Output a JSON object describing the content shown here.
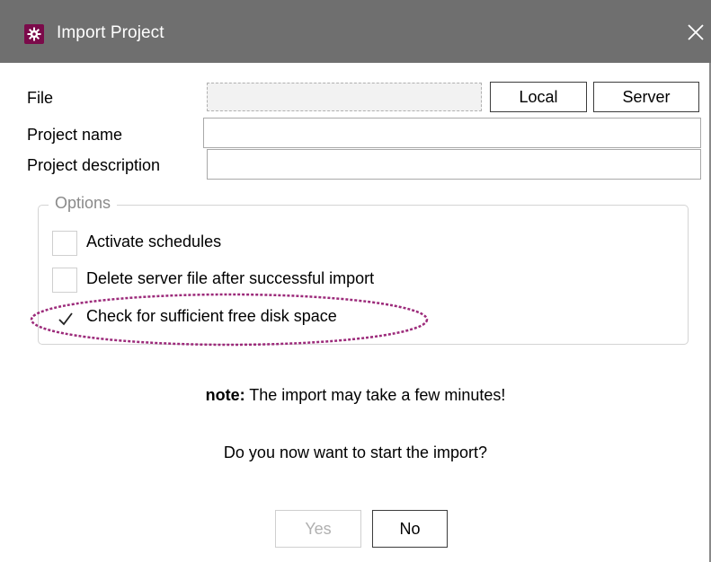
{
  "window": {
    "title": "Import Project",
    "titlebar_color": "#6f6f6f",
    "icon": "gear-icon",
    "close_icon": "close-icon"
  },
  "form": {
    "file_label": "File",
    "file_value": "",
    "local_button": "Local",
    "server_button": "Server",
    "name_label": "Project name",
    "name_value": "",
    "description_label": "Project description",
    "description_value": ""
  },
  "options": {
    "legend": "Options",
    "items": [
      {
        "label": "Activate schedules",
        "checked": false
      },
      {
        "label": "Delete server file after successful import",
        "checked": false
      },
      {
        "label": "Check for sufficient free disk space",
        "checked": true
      }
    ],
    "highlight_color": "#9c2a7a"
  },
  "messages": {
    "note_bold": "note:",
    "note_text": " The import may take a few minutes!",
    "question": "Do you now want to start the import?"
  },
  "buttons": {
    "yes": "Yes",
    "yes_enabled": false,
    "no": "No"
  }
}
